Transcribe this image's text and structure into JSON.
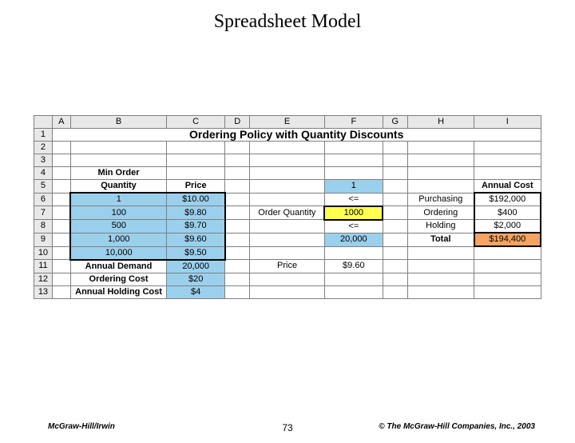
{
  "slide": {
    "title": "Spreadsheet Model"
  },
  "columns": [
    "A",
    "B",
    "C",
    "D",
    "E",
    "F",
    "G",
    "H",
    "I"
  ],
  "rows": [
    "1",
    "2",
    "3",
    "4",
    "5",
    "6",
    "7",
    "8",
    "9",
    "10",
    "11",
    "12",
    "13"
  ],
  "cells": {
    "r1": {
      "title": "Ordering Policy with Quantity Discounts"
    },
    "r4": {
      "B": "Min Order"
    },
    "r5": {
      "B": "Quantity",
      "C": "Price",
      "F": "1",
      "I": "Annual Cost"
    },
    "r6": {
      "B": "1",
      "C": "$10.00",
      "F": "<=",
      "H": "Purchasing",
      "I": "$192,000"
    },
    "r7": {
      "B": "100",
      "C": "$9.80",
      "E": "Order Quantity",
      "F": "1000",
      "H": "Ordering",
      "I": "$400"
    },
    "r8": {
      "B": "500",
      "C": "$9.70",
      "F": "<=",
      "H": "Holding",
      "I": "$2,000"
    },
    "r9": {
      "B": "1,000",
      "C": "$9.60",
      "F": "20,000",
      "H": "Total",
      "I": "$194,400"
    },
    "r10": {
      "B": "10,000",
      "C": "$9.50"
    },
    "r11": {
      "B": "Annual Demand",
      "C": "20,000",
      "E": "Price",
      "F": "$9.60"
    },
    "r12": {
      "B": "Ordering Cost",
      "C": "$20"
    },
    "r13": {
      "B": "Annual Holding Cost",
      "C": "$4"
    }
  },
  "footer": {
    "left": "McGraw-Hill/Irwin",
    "center": "73",
    "right": "© The McGraw-Hill Companies, Inc., 2003"
  }
}
